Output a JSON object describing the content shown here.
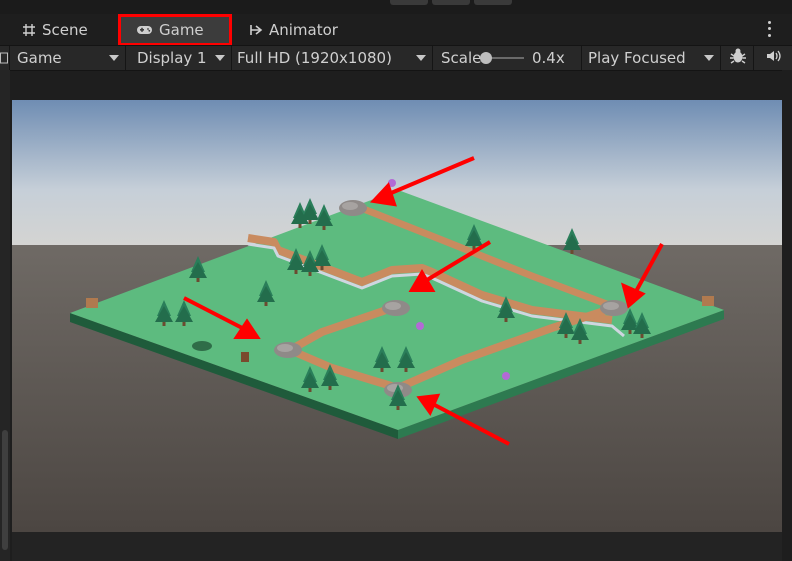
{
  "tabs": [
    {
      "label": "Scene",
      "icon": "grid-icon"
    },
    {
      "label": "Game",
      "icon": "gamepad-icon",
      "active": true
    },
    {
      "label": "Animator",
      "icon": "animator-icon"
    }
  ],
  "toolbar": {
    "view": "Game",
    "display": "Display 1",
    "resolution": "Full HD (1920x1080)",
    "scale_label": "Scale",
    "scale_value": "0.4x",
    "play_mode": "Play Focused"
  },
  "colors": {
    "highlight": "#ff0000",
    "arrow": "#ff0000",
    "grass": "#5dbb7f",
    "path": "#c98b5f"
  },
  "annotations": {
    "arrow_count": 5,
    "highlighted_tab": "Game"
  }
}
